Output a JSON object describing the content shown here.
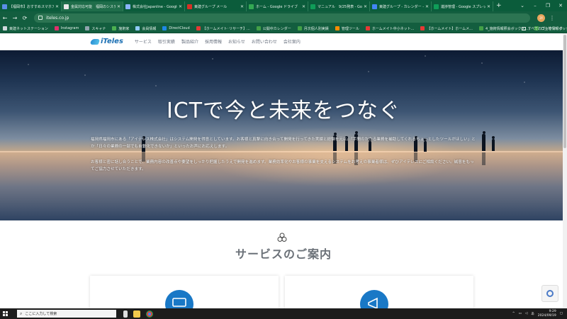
{
  "browser": {
    "tabs": [
      {
        "label": "【福岡市】おすすめスマホアプ",
        "color": "#5b8ee6",
        "active": false
      },
      {
        "label": "金属対応可能　福岡のシステム",
        "color": "#e8e8e8",
        "active": true
      },
      {
        "label": "株式会社Japanline - Google",
        "color": "#8ab4f8",
        "active": false
      },
      {
        "label": "東建グループ メール",
        "color": "#d93025",
        "active": false
      },
      {
        "label": "ホーム - Google ドライブ",
        "color": "#34a853",
        "active": false
      },
      {
        "label": "マニュアル　9/25発表 - Goo",
        "color": "#0f9d58",
        "active": false
      },
      {
        "label": "東建グループ - カレンダー - 週",
        "color": "#4285f4",
        "active": false
      },
      {
        "label": "進捗管理 - Google スプレッ",
        "color": "#0f9d58",
        "active": false
      }
    ],
    "new_tab": "+",
    "window_controls": [
      "⌄",
      "–",
      "❐",
      "✕"
    ],
    "address": "iteles.co.jp",
    "profile_initials": "ﾕｷ",
    "bookmarks": [
      {
        "label": "東建ネットステーション",
        "color": "#cfd8dc"
      },
      {
        "label": "Instagram",
        "color": "#e1306c"
      },
      {
        "label": "スキャナ",
        "color": "#90a4ae"
      },
      {
        "label": "施術家",
        "color": "#4caf50"
      },
      {
        "label": "会員情報",
        "color": "#90caf9"
      },
      {
        "label": "DirectCloud",
        "color": "#1e88e5"
      },
      {
        "label": "【ホームメイト･リサーチ】...",
        "color": "#e53935"
      },
      {
        "label": "公開中カレンダー",
        "color": "#43a047"
      },
      {
        "label": "月次個人別実績",
        "color": "#43a047"
      },
      {
        "label": "管理ツール",
        "color": "#fb8c00"
      },
      {
        "label": "ホームメイト中小ネット...",
        "color": "#e53935"
      },
      {
        "label": "【ホームメイト】ホームメ...",
        "color": "#e53935"
      },
      {
        "label": "4_施術情報照会ボックス...",
        "color": "#43a047"
      },
      {
        "label": "口土地情報ボックス...",
        "color": "#43a047"
      }
    ],
    "all_bookmarks": "すべてのブックマーク"
  },
  "site": {
    "logo": "iTeles",
    "nav": [
      "サービス",
      "取引実績",
      "製品紹介",
      "採用情報",
      "お知らせ",
      "お問い合わせ",
      "会社案内"
    ],
    "hero": {
      "title": "ICTで今と未来をつなぐ",
      "p1": "福岡県福岡市にある「アイテレス株式会社」はシステム開発を得意としています。お客様と真摯に向き合って開発を行ってきた実績と経験を元に、「手間のかかる業務を補助してくれるちょっとしたツールがほしい」とか「日々の業務の一部でも自動化できないか」といったお声にお応えします。",
      "p2": "お客様と密に話し合うことで、業務内容の改善点や要望をしっかり把握したうえで開発を進めます。業務効率化やお客様の事業を支えるシステムをお考えの事業者様は、ぜひアイテレスにご相談ください。誠意をもってご協力させていただきます。"
    },
    "services_title": "サービスのご案内"
  },
  "taskbar": {
    "search_placeholder": "ここに入力して検索",
    "time": "9:29",
    "date": "2024/09/19",
    "lang": "あ"
  }
}
